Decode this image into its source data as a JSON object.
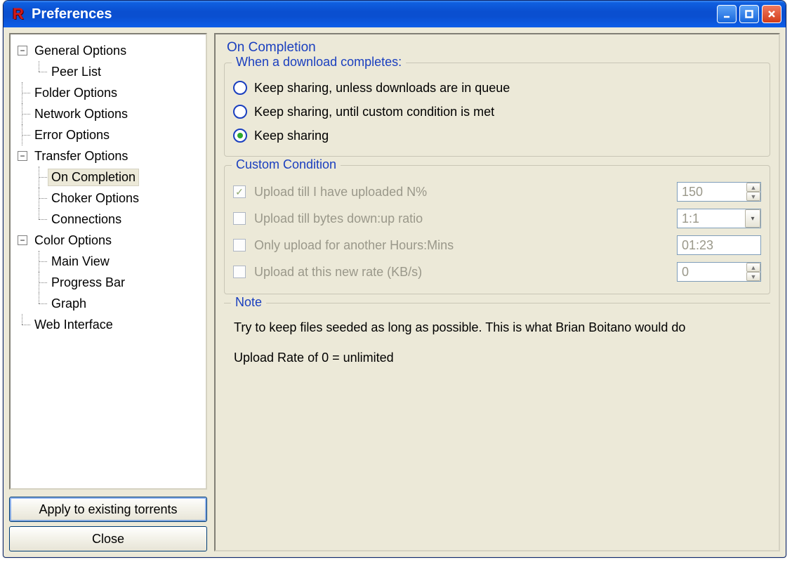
{
  "window": {
    "title": "Preferences",
    "icon_letter": "R"
  },
  "tree": {
    "general": "General Options",
    "general_children": {
      "peer_list": "Peer List"
    },
    "folder": "Folder Options",
    "network": "Network Options",
    "error": "Error Options",
    "transfer": "Transfer Options",
    "transfer_children": {
      "on_completion": "On Completion",
      "choker": "Choker Options",
      "connections": "Connections"
    },
    "color": "Color Options",
    "color_children": {
      "main_view": "Main View",
      "progress_bar": "Progress Bar",
      "graph": "Graph"
    },
    "web": "Web Interface",
    "selected": "On Completion"
  },
  "buttons": {
    "apply": "Apply to existing torrents",
    "close": "Close"
  },
  "page": {
    "title": "On Completion",
    "group1": {
      "legend": "When a download completes:",
      "options": {
        "opt0": "Keep sharing, unless downloads are in queue",
        "opt1": "Keep sharing, until custom condition is met",
        "opt2": "Keep sharing"
      },
      "selected_index": 2
    },
    "group2": {
      "legend": "Custom Condition",
      "rows": {
        "r0": {
          "label": "Upload till I have uploaded N%",
          "value": "150",
          "checked": true,
          "type": "spin"
        },
        "r1": {
          "label": "Upload till bytes down:up ratio",
          "value": "1:1",
          "checked": false,
          "type": "select"
        },
        "r2": {
          "label": "Only upload for another Hours:Mins",
          "value": "01:23",
          "checked": false,
          "type": "text"
        },
        "r3": {
          "label": "Upload at this new rate (KB/s)",
          "value": "0",
          "checked": false,
          "type": "spin"
        }
      }
    },
    "note": {
      "legend": "Note",
      "line1": "Try to keep files seeded as long as possible. This is what Brian Boitano would do",
      "line2": "Upload Rate of 0 = unlimited"
    }
  }
}
